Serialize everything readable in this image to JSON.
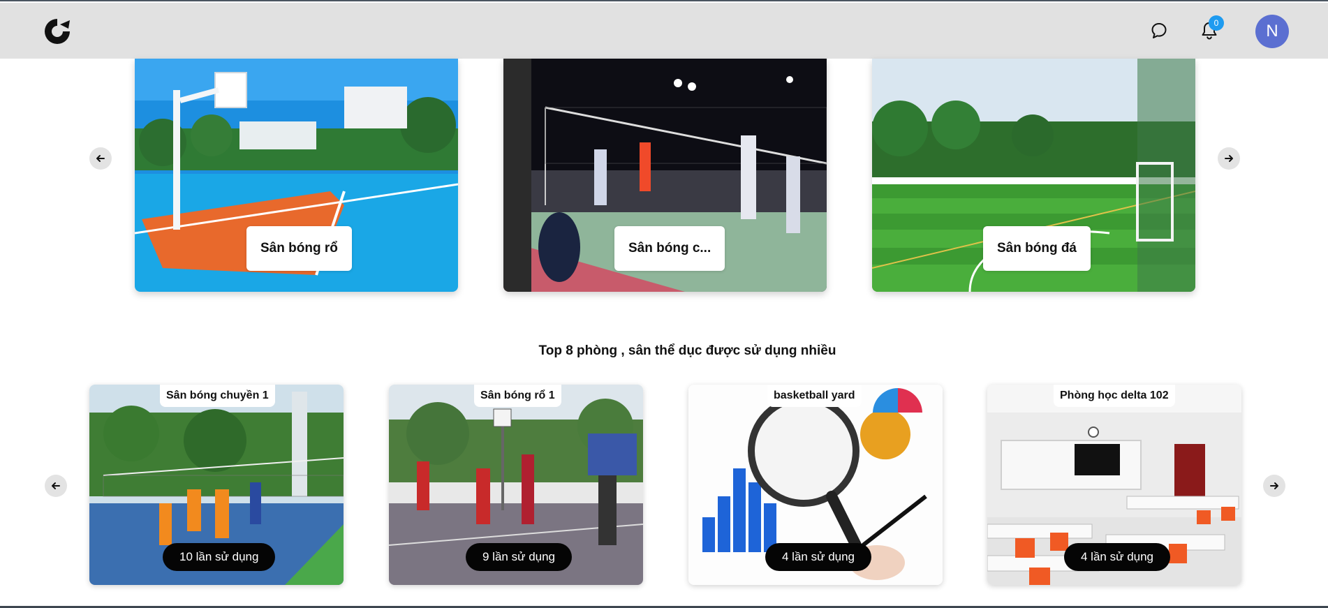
{
  "header": {
    "logo": "brand-logo",
    "chat_icon": "chat-bubble-icon",
    "bell_icon": "bell-icon",
    "notification_count": "0",
    "avatar_initial": "N",
    "colors": {
      "header_bg": "#e1e1e1",
      "badge": "#1e9bf0",
      "avatar": "#5b6fd1"
    }
  },
  "categories": {
    "prev_icon": "arrow-left-icon",
    "next_icon": "arrow-right-icon",
    "items": [
      {
        "label": "Sân bóng rổ",
        "image": "outdoor basketball court photo"
      },
      {
        "label": "Sân bóng c...",
        "image": "night volleyball court photo"
      },
      {
        "label": "Sân bóng đá",
        "image": "artificial turf football field photo"
      }
    ]
  },
  "top_section": {
    "title": "Top 8 phòng , sân thể dục được sử dụng nhiều",
    "prev_icon": "arrow-left-icon",
    "next_icon": "arrow-right-icon",
    "items": [
      {
        "name": "Sân bóng chuyền 1",
        "usage": "10 lần sử dụng"
      },
      {
        "name": "Sân bóng rổ 1",
        "usage": "9 lần sử dụng"
      },
      {
        "name": "basketball yard",
        "usage": "4 lần sử dụng"
      },
      {
        "name": "Phòng học delta 102",
        "usage": "4 lần sử dụng"
      }
    ]
  }
}
